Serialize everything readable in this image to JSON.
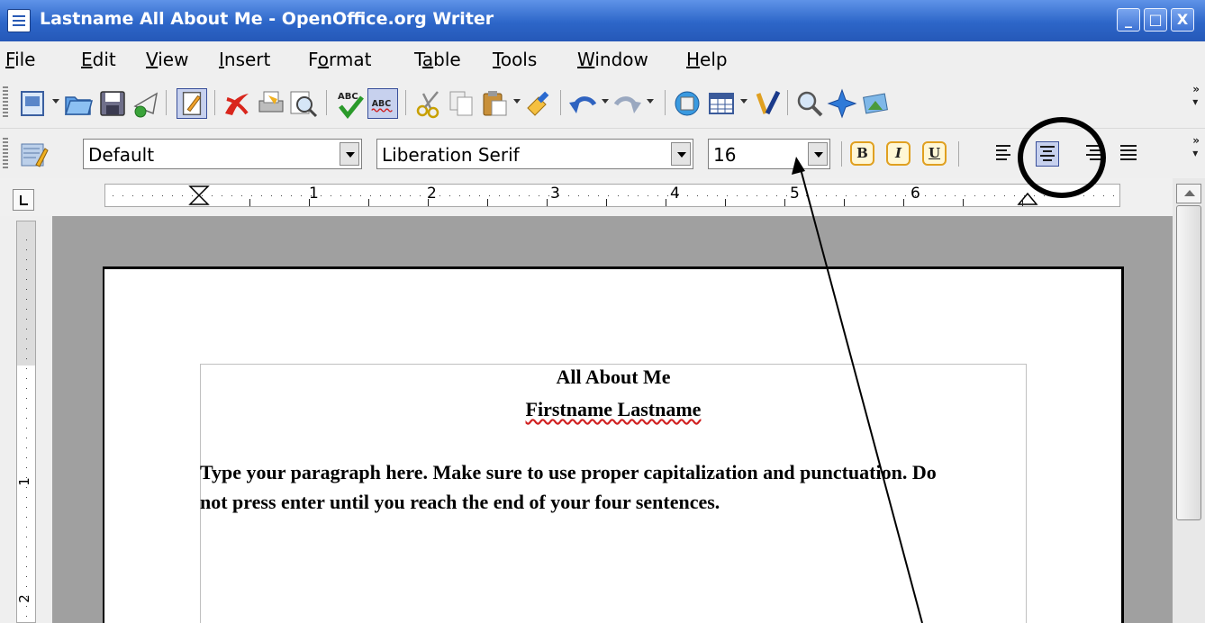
{
  "window": {
    "title": "Lastname All About Me - OpenOffice.org Writer",
    "buttons": {
      "minimize": "_",
      "maximize": "□",
      "close": "X"
    }
  },
  "menu": [
    {
      "label": "File",
      "key": "F",
      "rest": "ile"
    },
    {
      "label": "Edit",
      "key": "E",
      "rest": "dit"
    },
    {
      "label": "View",
      "key": "V",
      "rest": "iew"
    },
    {
      "label": "Insert",
      "key": "I",
      "rest": "nsert"
    },
    {
      "label": "Format",
      "pre": "F",
      "key": "o",
      "rest": "rmat"
    },
    {
      "label": "Table",
      "pre": "T",
      "key": "a",
      "rest": "ble"
    },
    {
      "label": "Tools",
      "key": "T",
      "rest": "ools"
    },
    {
      "label": "Window",
      "key": "W",
      "rest": "indow"
    },
    {
      "label": "Help",
      "key": "H",
      "rest": "elp"
    }
  ],
  "format_toolbar": {
    "style": "Default",
    "font": "Liberation Serif",
    "size": "16",
    "bold": "B",
    "italic": "I",
    "underline": "U"
  },
  "ruler": {
    "numbers": [
      "1",
      "2",
      "3",
      "4",
      "5",
      "6"
    ],
    "vertical_numbers": [
      "1",
      "2"
    ]
  },
  "document": {
    "title": "All About Me",
    "name": "Firstname Lastname",
    "paragraph": "Type your paragraph here.  Make sure to use proper capitalization and punctuation.  Do not press enter until you reach the end of your four sentences."
  },
  "icons": {
    "standard_toolbar": [
      "new-document-icon",
      "open-icon",
      "save-icon",
      "email-icon",
      "edit-mode-icon",
      "export-pdf-icon",
      "print-icon",
      "page-preview-icon",
      "spellcheck-icon",
      "autospell-icon",
      "cut-icon",
      "copy-icon",
      "paste-icon",
      "format-paintbrush-icon",
      "undo-icon",
      "redo-icon",
      "hyperlink-icon",
      "table-icon",
      "show-draw-functions-icon",
      "find-replace-icon",
      "navigator-icon",
      "gallery-icon"
    ],
    "formatting_toolbar": [
      "styles-icon",
      "align-left-icon",
      "align-center-icon",
      "align-right-icon",
      "justify-icon"
    ]
  },
  "colors": {
    "titlebar": "#2d66c8",
    "spell_underline": "#d02020",
    "active_align": "#c7d1ee"
  }
}
